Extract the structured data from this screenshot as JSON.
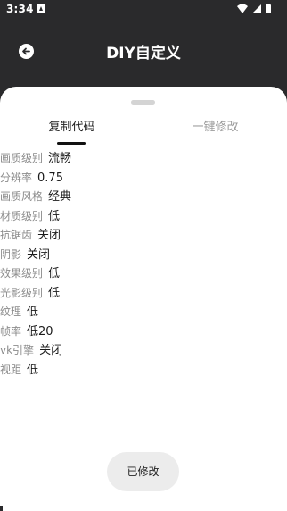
{
  "status_bar": {
    "time": "3:34",
    "icons": [
      "notification-icon",
      "wifi-icon",
      "signal-icon",
      "battery-icon"
    ]
  },
  "app_bar": {
    "title": "DIY自定义",
    "back_icon": "back-arrow-icon"
  },
  "tabs": [
    {
      "label": "复制代码",
      "active": true
    },
    {
      "label": "一键修改",
      "active": false
    }
  ],
  "settings": [
    {
      "label": "画质级别",
      "value": "流畅"
    },
    {
      "label": "分辨率",
      "value": "0.75"
    },
    {
      "label": "画质风格",
      "value": "经典"
    },
    {
      "label": "材质级别",
      "value": "低"
    },
    {
      "label": "抗锯齿",
      "value": "关闭"
    },
    {
      "label": "阴影",
      "value": "关闭"
    },
    {
      "label": "效果级别",
      "value": "低"
    },
    {
      "label": "光影级别",
      "value": "低"
    },
    {
      "label": "纹理",
      "value": "低"
    },
    {
      "label": "帧率",
      "value": "低20"
    },
    {
      "label": "vk引擎",
      "value": "关闭"
    },
    {
      "label": "视距",
      "value": "低"
    }
  ],
  "action_button": {
    "label": "已修改"
  },
  "colors": {
    "app_bar_bg": "#2a2a2c",
    "sheet_bg": "#ffffff",
    "tab_active": "#222222",
    "tab_inactive": "#9a9a9a",
    "button_bg": "#ececec"
  }
}
